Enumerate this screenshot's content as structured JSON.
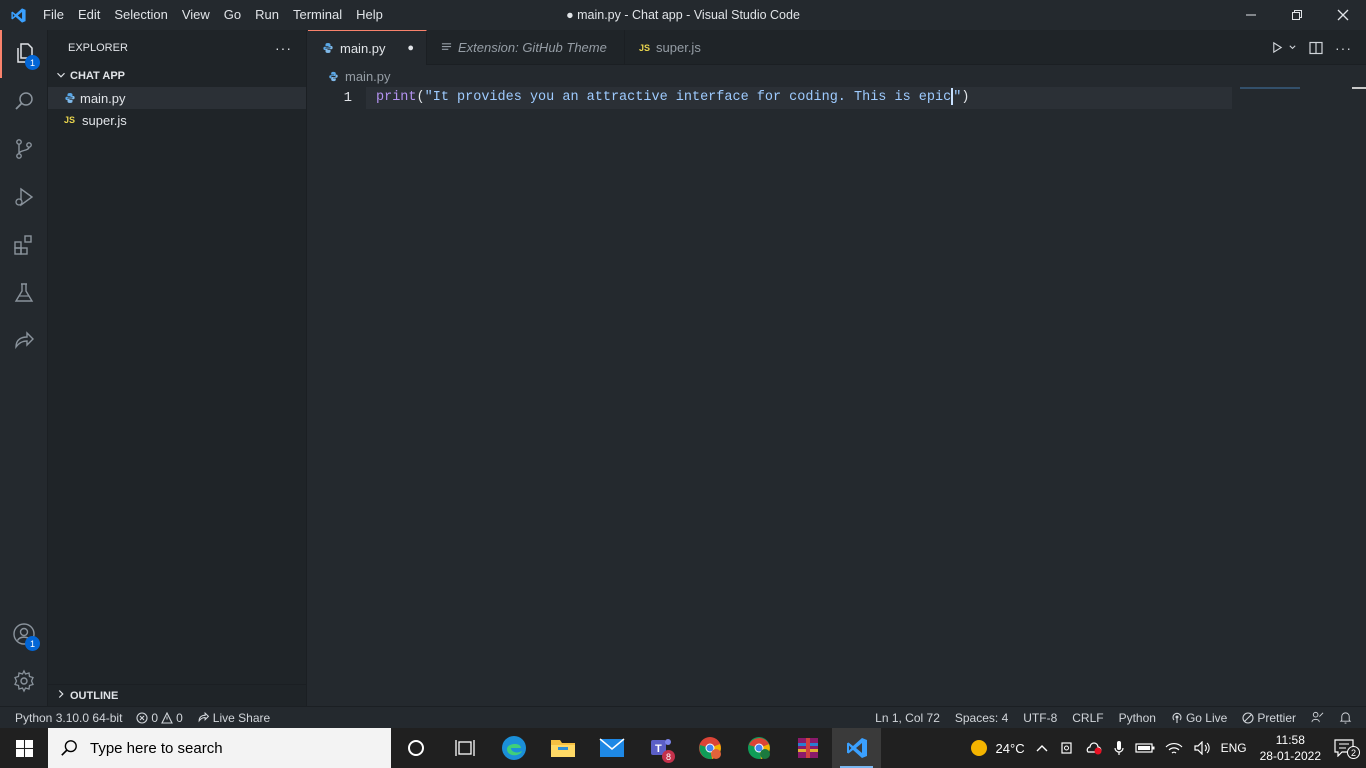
{
  "menu": [
    "File",
    "Edit",
    "Selection",
    "View",
    "Go",
    "Run",
    "Terminal",
    "Help"
  ],
  "window_title": "● main.py - Chat app - Visual Studio Code",
  "activity": {
    "explorer_badge": "1",
    "accounts_badge": "1"
  },
  "sidebar": {
    "header": "EXPLORER",
    "more": "···",
    "folder": "CHAT APP",
    "files": [
      {
        "icon": "py",
        "name": "main.py"
      },
      {
        "icon": "JS",
        "name": "super.js"
      }
    ],
    "outline": "OUTLINE"
  },
  "tabs": [
    {
      "label": "main.py",
      "dirty": "●"
    },
    {
      "label": "Extension: GitHub Theme"
    },
    {
      "label": "super.js",
      "icon": "JS"
    }
  ],
  "breadcrumb": "main.py",
  "editor": {
    "line_number": "1",
    "fn": "print",
    "open": "(",
    "string_a": "\"It provides you an attractive interface for coding. This is epic",
    "string_b": "\"",
    "close": ")"
  },
  "status": {
    "interpreter": "Python 3.10.0 64-bit",
    "errors": "0",
    "warnings": "0",
    "live_share": "Live Share",
    "position": "Ln 1, Col 72",
    "spaces": "Spaces: 4",
    "encoding": "UTF-8",
    "eol": "CRLF",
    "language": "Python",
    "go_live": "Go Live",
    "prettier": "Prettier"
  },
  "taskbar": {
    "search_placeholder": "Type here to search",
    "temperature": "24°C",
    "lang": "ENG",
    "time": "11:58",
    "date": "28-01-2022",
    "notif_count": "2",
    "teams_badge": "8"
  }
}
